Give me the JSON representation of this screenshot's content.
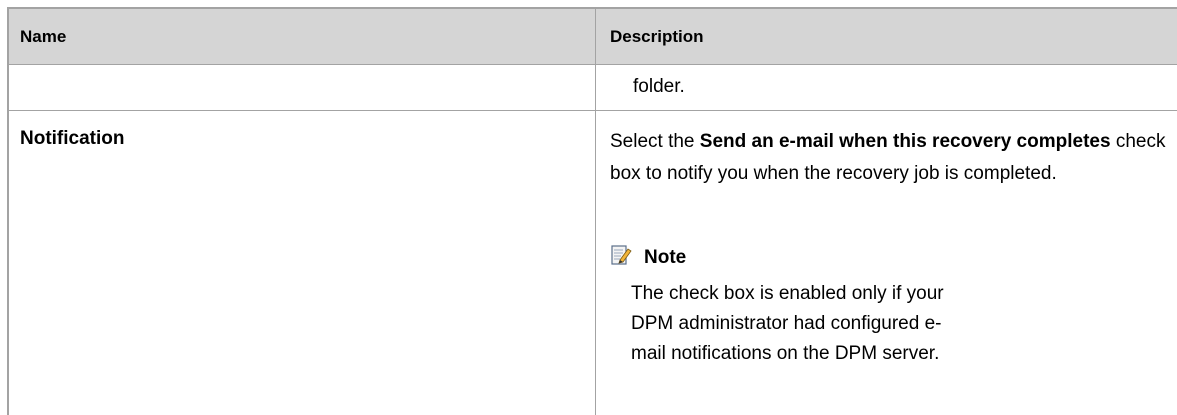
{
  "table": {
    "headers": {
      "name": "Name",
      "description": "Description"
    },
    "rows": [
      {
        "name": "",
        "description": "folder."
      },
      {
        "name": "Notification",
        "description_parts": [
          "Select the ",
          "Send an e-mail when this recovery completes",
          " check box to notify you when the recovery job is completed."
        ],
        "note": {
          "icon": "note-pencil-icon",
          "title": "Note",
          "text": "The check box is enabled only if your DPM administrator had configured e-mail notifications on the DPM server."
        }
      }
    ]
  }
}
